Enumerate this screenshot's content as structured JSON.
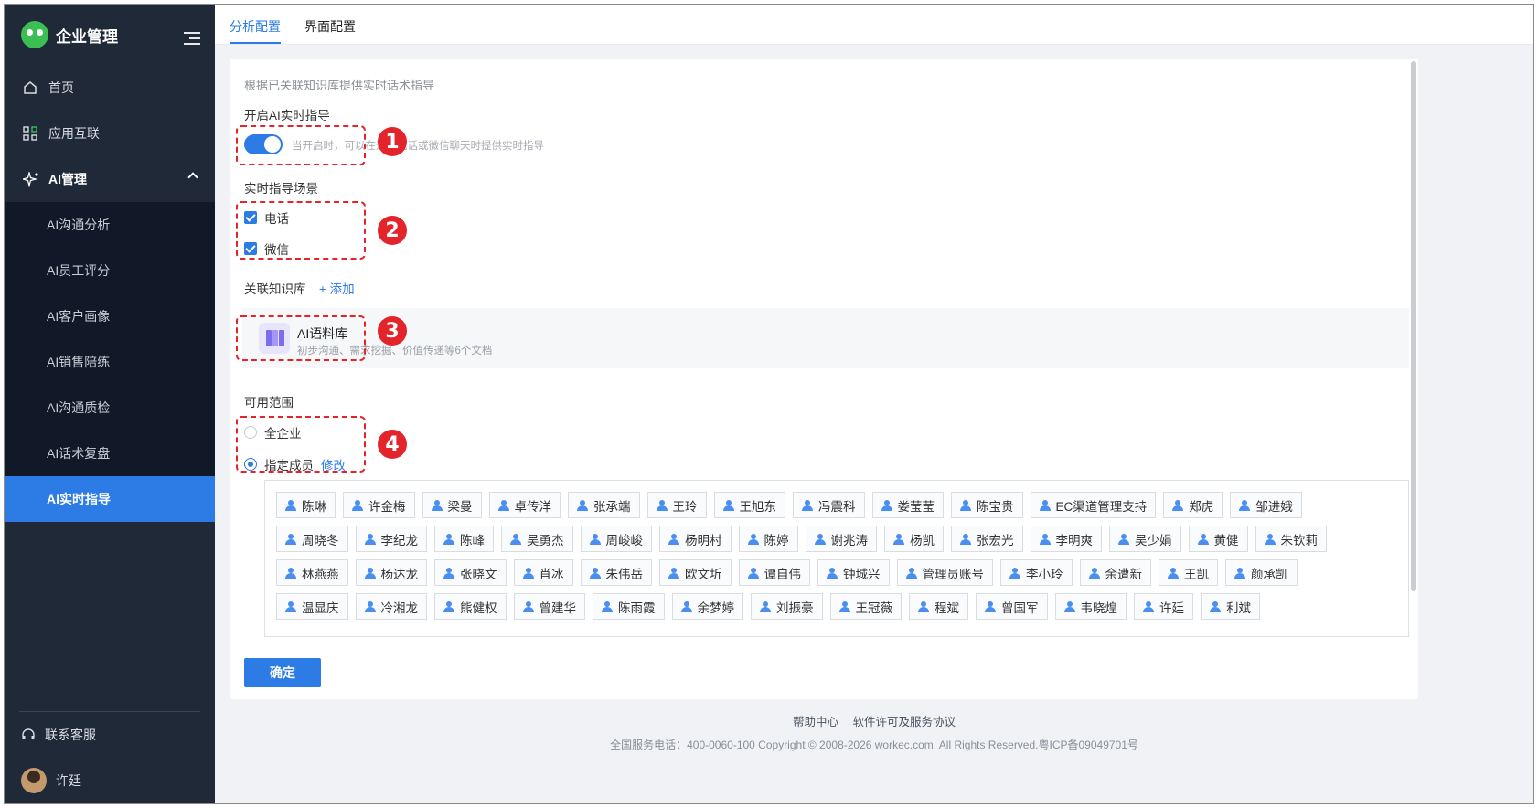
{
  "app": {
    "title": "企业管理"
  },
  "sidebar": {
    "items": [
      {
        "label": "首页",
        "icon": "home-icon"
      },
      {
        "label": "应用互联",
        "icon": "apps-icon"
      }
    ],
    "group": {
      "label": "AI管理",
      "icon": "ai-sparkle-icon"
    },
    "submenu": [
      {
        "label": "AI沟通分析"
      },
      {
        "label": "AI员工评分"
      },
      {
        "label": "AI客户画像"
      },
      {
        "label": "AI销售陪练"
      },
      {
        "label": "AI沟通质检"
      },
      {
        "label": "AI话术复盘"
      },
      {
        "label": "AI实时指导",
        "active": true
      }
    ],
    "support": {
      "label": "联系客服",
      "icon": "headset-icon"
    },
    "user": {
      "name": "许廷"
    }
  },
  "tabs": [
    {
      "label": "分析配置",
      "active": true
    },
    {
      "label": "界面配置"
    }
  ],
  "content": {
    "description": "根据已关联知识库提供实时话术指导",
    "ai_switch": {
      "label": "开启AI实时指导",
      "on": true,
      "hint": "当开启时，可以在通过电话或微信聊天时提供实时指导"
    },
    "scenes": {
      "label": "实时指导场景",
      "options": [
        {
          "label": "电话",
          "checked": true
        },
        {
          "label": "微信",
          "checked": true
        }
      ]
    },
    "knowledge": {
      "label": "关联知识库",
      "add_label": "+ 添加",
      "card": {
        "title": "AI语料库",
        "subtitle": "初步沟通、需求挖掘、价值传递等6个文档"
      }
    },
    "scope": {
      "label": "可用范围",
      "options": [
        {
          "label": "全企业",
          "selected": false
        },
        {
          "label": "指定成员",
          "selected": true
        }
      ],
      "edit_label": "修改"
    },
    "members": [
      "陈琳",
      "许金梅",
      "梁曼",
      "卓传洋",
      "张承端",
      "王玲",
      "王旭东",
      "冯震科",
      "娄莹莹",
      "陈宝贵",
      "EC渠道管理支持",
      "郑虎",
      "邹进娥",
      "周晓冬",
      "李纪龙",
      "陈峰",
      "吴勇杰",
      "周峻峻",
      "杨明村",
      "陈婷",
      "谢兆涛",
      "杨凯",
      "张宏光",
      "李明爽",
      "吴少娟",
      "黄健",
      "朱钦莉",
      "林燕燕",
      "杨达龙",
      "张晓文",
      "肖冰",
      "朱伟岳",
      "欧文圻",
      "谭自伟",
      "钟城兴",
      "管理员账号",
      "李小玲",
      "余遭新",
      "王凯",
      "颜承凯",
      "温显庆",
      "冷湘龙",
      "熊健权",
      "曾建华",
      "陈雨霞",
      "余梦婷",
      "刘振豪",
      "王冠薇",
      "程斌",
      "曾国军",
      "韦晓煌",
      "许廷",
      "利斌"
    ],
    "confirm_label": "确定"
  },
  "annotations": [
    "1",
    "2",
    "3",
    "4"
  ],
  "footer": {
    "links": [
      "帮助中心",
      "软件许可及服务协议"
    ],
    "copyright": "全国服务电话：400-0060-100 Copyright © 2008-2026 workec.com, All Rights Reserved.粤ICP备09049701号"
  },
  "colors": {
    "accent": "#2d7be5",
    "sidebar_bg": "#1f2937",
    "annotation": "#e3242b"
  }
}
